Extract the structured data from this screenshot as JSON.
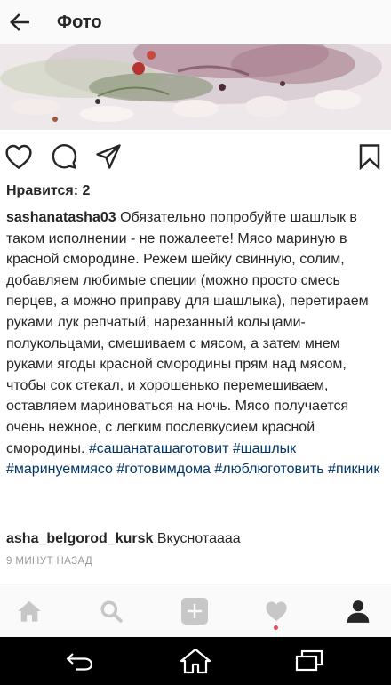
{
  "header": {
    "title": "Фото",
    "back_icon": "arrow-left-icon"
  },
  "post": {
    "actions": [
      "heart-icon",
      "comment-icon",
      "share-icon",
      "bookmark-icon"
    ],
    "likes_label": "Нравится: 2",
    "author": "sashanatasha03",
    "caption_text": "Обязательно попробуйте шашлык в таком исполнении - не пожалеете! Мясо мариную в красной смородине. Режем шейку свинную,  солим,  добавляем любимые специи (можно просто смесь перцев,  а можно приправу для шашлыка), перетираем руками лук репчатый,  нарезанный кольцами-полукольцами, смешиваем с мясом,  а затем мнем руками ягоды красной смородины прям над мясом,  чтобы сок стекал,  и хорошенько перемешиваем,  оставляем мариноваться на ночь.  Мясо получается очень нежное,  с легким послевкусием красной смородины.",
    "hashtags": [
      "#сашанаташаготовит",
      "#шашлык",
      "#маринуеммясо",
      "#готовимдома",
      "#люблюготовить",
      "#пикник"
    ],
    "comment": {
      "author": "asha_belgorod_kursk",
      "text": "Вкуснотаааа"
    },
    "timestamp": "9 МИНУТ НАЗАД"
  },
  "tabbar": {
    "items": [
      "home-icon",
      "search-icon",
      "add-icon",
      "activity-icon",
      "profile-icon"
    ],
    "active": "profile-icon",
    "activity_dot_color": "#ed4956"
  },
  "system_nav": {
    "items": [
      "back-icon",
      "home-icon",
      "recents-icon"
    ]
  },
  "colors": {
    "hashtag": "#003569",
    "text": "#262626",
    "muted": "#999999",
    "tab_inactive": "#c7c7c7"
  }
}
